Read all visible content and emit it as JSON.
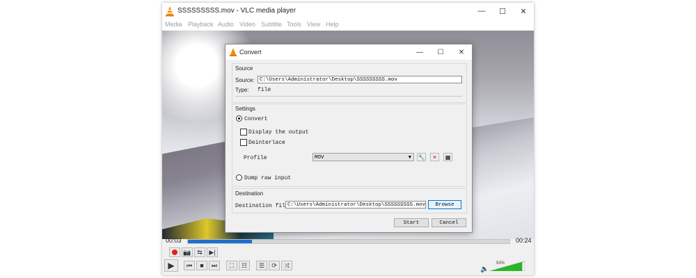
{
  "window": {
    "title": "SSSSSSSSS.mov - VLC media player",
    "controls": {
      "minimize": "—",
      "maximize": "☐",
      "close": "✕"
    }
  },
  "menu": [
    "Media",
    "Playback",
    "Audio",
    "Video",
    "Subtitle",
    "Tools",
    "View",
    "Help"
  ],
  "player": {
    "elapsed": "00:03",
    "total": "00:24",
    "progress": 0.2,
    "volume_label": "93%",
    "volume": 0.93
  },
  "dialog": {
    "title": "Convert",
    "controls": {
      "minimize": "—",
      "maximize": "☐",
      "close": "✕"
    },
    "source": {
      "group_label": "Source",
      "source_label": "Source:",
      "source_value": "C:\\Users\\Administrator\\Desktop\\SSSSSSSSS.mov",
      "type_label": "Type:",
      "type_value": "file"
    },
    "settings": {
      "group_label": "Settings",
      "convert_label": "Convert",
      "display_output_label": "Display the output",
      "deinterlace_label": "Deinterlace",
      "profile_label": "Profile",
      "profile_value": "MOV",
      "dump_raw_label": "Dump raw input"
    },
    "destination": {
      "group_label": "Destination",
      "file_label": "Destination file:",
      "file_value": "C:\\Users\\Administrator\\Desktop\\SSSSSSSSS.mov",
      "browse_label": "Browse"
    },
    "start_label": "Start",
    "cancel_label": "Cancel"
  },
  "colors": {
    "accent": "#1e6fd0",
    "vlc_orange": "#f08c00",
    "record_red": "#e0201e",
    "volume_green": "#2bb52b"
  }
}
